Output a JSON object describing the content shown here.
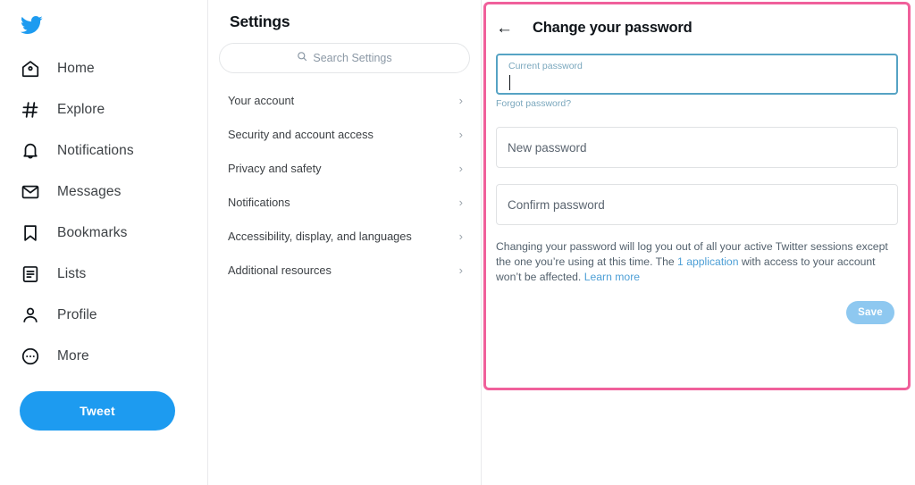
{
  "sidebar": {
    "logo_icon": "twitter-bird-icon",
    "items": [
      {
        "label": "Home",
        "icon": "home-icon"
      },
      {
        "label": "Explore",
        "icon": "hashtag-icon"
      },
      {
        "label": "Notifications",
        "icon": "bell-icon"
      },
      {
        "label": "Messages",
        "icon": "envelope-icon"
      },
      {
        "label": "Bookmarks",
        "icon": "bookmark-icon"
      },
      {
        "label": "Lists",
        "icon": "list-icon"
      },
      {
        "label": "Profile",
        "icon": "person-icon"
      },
      {
        "label": "More",
        "icon": "more-circle-icon"
      }
    ],
    "tweet_button": "Tweet"
  },
  "settings": {
    "title": "Settings",
    "search_placeholder": "Search Settings",
    "search_icon": "search-icon",
    "rows": [
      {
        "label": "Your account"
      },
      {
        "label": "Security and account access"
      },
      {
        "label": "Privacy and safety"
      },
      {
        "label": "Notifications"
      },
      {
        "label": "Accessibility, display, and languages"
      },
      {
        "label": "Additional resources"
      }
    ],
    "chevron": "›"
  },
  "main": {
    "back_icon": "back-arrow-icon",
    "back_glyph": "←",
    "title": "Change your password",
    "fields": {
      "current": {
        "label": "Current password",
        "value": ""
      },
      "new": {
        "placeholder": "New password",
        "value": ""
      },
      "confirm": {
        "placeholder": "Confirm password",
        "value": ""
      }
    },
    "forgot_link": "Forgot password?",
    "description": {
      "part1": "Changing your password will log you out of all your active Twitter sessions except the one you’re using at this time. The ",
      "link1": "1 application",
      "part2": " with access to your account won’t be affected. ",
      "link2": "Learn more"
    },
    "save_label": "Save"
  },
  "colors": {
    "brand_blue": "#1d9bf0",
    "highlight_pink": "#f0609b",
    "focus_border": "#56a3c4",
    "link_blue": "#4d9fd6",
    "save_disabled": "#8ec8f0",
    "text_primary": "#0f1419",
    "text_secondary": "#53616d"
  }
}
